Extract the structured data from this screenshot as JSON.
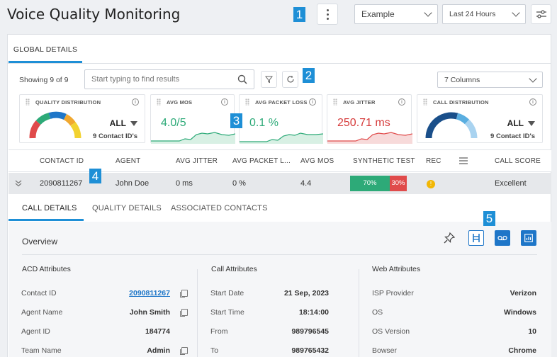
{
  "header": {
    "title": "Voice Quality Monitoring",
    "callouts": [
      "1",
      "2",
      "3",
      "4",
      "5"
    ],
    "view_select": "Example",
    "range_select": "Last 24 Hours"
  },
  "tabs": {
    "global": "GLOBAL DETAILS"
  },
  "toolbar": {
    "showing": "Showing 9 of 9",
    "search_placeholder": "Start typing to find results",
    "columns_select": "7 Columns"
  },
  "kpis": {
    "quality": {
      "title": "QUALITY DISTRIBUTION",
      "value": "ALL",
      "sub": "9 Contact ID's"
    },
    "mos": {
      "title": "AVG MOS",
      "value": "4.0/5"
    },
    "packet_loss": {
      "title": "AVG PACKET LOSS",
      "value": "0.1 %"
    },
    "jitter": {
      "title": "AVG JITTER",
      "value": "250.71 ms"
    },
    "call_dist": {
      "title": "CALL DISTRIBUTION",
      "value": "ALL",
      "sub": "9 Contact ID's"
    }
  },
  "table": {
    "headers": [
      "CONTACT ID",
      "AGENT",
      "AVG JITTER",
      "AVG PACKET L...",
      "AVG MOS",
      "SYNTHETIC TEST",
      "REC",
      "CALL SCORE"
    ],
    "row": {
      "contact_id": "2090811267",
      "agent": "John Doe",
      "jitter": "0 ms",
      "packet_loss": "0 %",
      "mos": "4.4",
      "synthetic_pass": "70%",
      "synthetic_fail": "30%",
      "synthetic_pass_fraction": 0.7,
      "call_score": "Excellent"
    }
  },
  "subtabs": [
    "CALL DETAILS",
    "QUALITY DETAILS",
    "ASSOCIATED CONTACTS"
  ],
  "overview": {
    "title": "Overview"
  },
  "acd": {
    "title": "ACD Attributes",
    "rows": [
      {
        "label": "Contact ID",
        "value": "2090811267"
      },
      {
        "label": "Agent Name",
        "value": "John Smith"
      },
      {
        "label": "Agent ID",
        "value": "184774"
      },
      {
        "label": "Team Name",
        "value": "Admin"
      }
    ]
  },
  "call": {
    "title": "Call Attributes",
    "rows": [
      {
        "label": "Start Date",
        "value": "21 Sep, 2023"
      },
      {
        "label": "Start Time",
        "value": "18:14:00"
      },
      {
        "label": "From",
        "value": "989796545"
      },
      {
        "label": "To",
        "value": "989765432"
      }
    ]
  },
  "web": {
    "title": "Web  Attributes",
    "rows": [
      {
        "label": "ISP Provider",
        "value": "Verizon"
      },
      {
        "label": "OS",
        "value": "Windows"
      },
      {
        "label": "OS Version",
        "value": "10"
      },
      {
        "label": "Bowser",
        "value": "Chrome"
      }
    ]
  },
  "colors": {
    "accent": "#1e8fd6",
    "good": "#2daa78",
    "bad": "#e04b4b",
    "gauge": [
      "#e04b4b",
      "#f0a830",
      "#f2d230",
      "#2daa78",
      "#1e76c8"
    ],
    "rec": "#f2b705"
  }
}
